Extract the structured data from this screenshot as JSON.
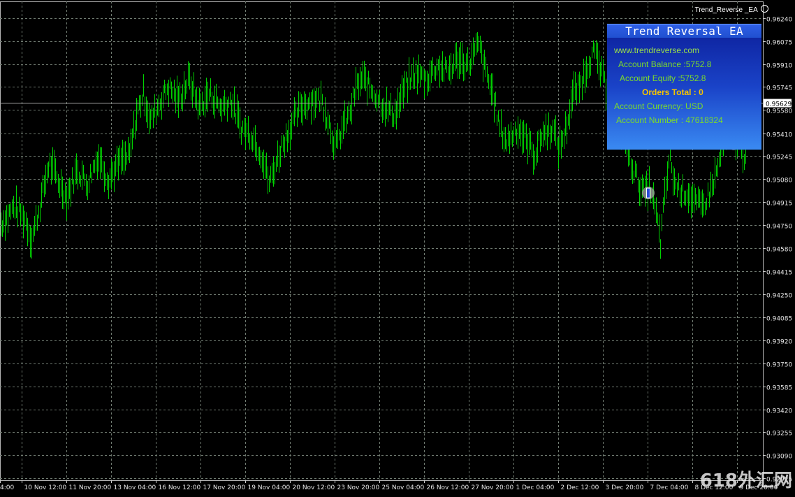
{
  "expert": {
    "name": "Trend_Reverse _EA",
    "status_icon": "smiley-icon"
  },
  "panel": {
    "title": "Trend Reversal EA",
    "url": "www.trendreverse.com",
    "account_balance": "Account Balance :5752.8",
    "account_equity": "Account Equity :5752.8",
    "orders_total": "Orders Total   : 0",
    "account_currency": "Account Currency:  USD",
    "account_number": "Account Number  :  47618324"
  },
  "watermark": "618外汇网",
  "colors": {
    "background": "#000000",
    "grid": "#6f7a70",
    "bars": "#00d200",
    "price_line": "#a8a8a8",
    "bid_label_bg": "#ffffff"
  },
  "chart_data": {
    "type": "bar",
    "current_price": "0.95629",
    "current_price_value": 0.95629,
    "ylim": [
      0.9285,
      0.964
    ],
    "y_ticks": [
      "0.96240",
      "0.96075",
      "0.95910",
      "0.95745",
      "0.95580",
      "0.95410",
      "0.95245",
      "0.95080",
      "0.94915",
      "0.94750",
      "0.94580",
      "0.94415",
      "0.94250",
      "0.94085",
      "0.93920",
      "0.93750",
      "0.93585",
      "0.93420",
      "0.93255",
      "0.93090",
      "0.92925"
    ],
    "y_tick_values": [
      0.9624,
      0.96075,
      0.9591,
      0.95745,
      0.9558,
      0.9541,
      0.95245,
      0.9508,
      0.94915,
      0.9475,
      0.9458,
      0.94415,
      0.9425,
      0.94085,
      0.9392,
      0.9375,
      0.93585,
      0.9342,
      0.93255,
      0.9309,
      0.92925
    ],
    "x_ticks": [
      "4:00",
      "10 Nov 12:00",
      "11 Nov 20:00",
      "13 Nov 04:00",
      "16 Nov 12:00",
      "17 Nov 20:00",
      "19 Nov 04:00",
      "20 Nov 12:00",
      "23 Nov 20:00",
      "25 Nov 04:00",
      "26 Nov 12:00",
      "27 Nov 20:00",
      "1 Dec 04:00",
      "2 Dec 12:00",
      "3 Dec 20:00",
      "7 Dec 04:00",
      "8 Dec 12:00",
      "9 Dec 20:00"
    ],
    "price_path": [
      [
        0,
        0.9475
      ],
      [
        20,
        0.9488
      ],
      [
        35,
        0.948
      ],
      [
        45,
        0.9465
      ],
      [
        55,
        0.9485
      ],
      [
        70,
        0.952
      ],
      [
        85,
        0.9505
      ],
      [
        95,
        0.9495
      ],
      [
        110,
        0.9515
      ],
      [
        125,
        0.9505
      ],
      [
        140,
        0.9525
      ],
      [
        155,
        0.9508
      ],
      [
        170,
        0.952
      ],
      [
        185,
        0.9525
      ],
      [
        195,
        0.9555
      ],
      [
        205,
        0.957
      ],
      [
        215,
        0.955
      ],
      [
        225,
        0.956
      ],
      [
        240,
        0.9575
      ],
      [
        255,
        0.9565
      ],
      [
        270,
        0.958
      ],
      [
        285,
        0.956
      ],
      [
        300,
        0.957
      ],
      [
        315,
        0.956
      ],
      [
        330,
        0.9565
      ],
      [
        345,
        0.9545
      ],
      [
        360,
        0.954
      ],
      [
        375,
        0.9525
      ],
      [
        385,
        0.9505
      ],
      [
        395,
        0.952
      ],
      [
        405,
        0.9535
      ],
      [
        415,
        0.9545
      ],
      [
        430,
        0.956
      ],
      [
        445,
        0.9565
      ],
      [
        460,
        0.9565
      ],
      [
        470,
        0.955
      ],
      [
        480,
        0.953
      ],
      [
        490,
        0.9545
      ],
      [
        500,
        0.9555
      ],
      [
        510,
        0.9575
      ],
      [
        520,
        0.958
      ],
      [
        535,
        0.957
      ],
      [
        550,
        0.956
      ],
      [
        565,
        0.9555
      ],
      [
        580,
        0.9575
      ],
      [
        595,
        0.9585
      ],
      [
        610,
        0.958
      ],
      [
        625,
        0.959
      ],
      [
        640,
        0.9585
      ],
      [
        655,
        0.9595
      ],
      [
        670,
        0.959
      ],
      [
        685,
        0.9605
      ],
      [
        695,
        0.9585
      ],
      [
        705,
        0.957
      ],
      [
        715,
        0.9545
      ],
      [
        725,
        0.9535
      ],
      [
        740,
        0.9545
      ],
      [
        755,
        0.9535
      ],
      [
        765,
        0.9525
      ],
      [
        775,
        0.954
      ],
      [
        790,
        0.9545
      ],
      [
        800,
        0.953
      ],
      [
        810,
        0.9545
      ],
      [
        820,
        0.957
      ],
      [
        830,
        0.9575
      ],
      [
        840,
        0.959
      ],
      [
        850,
        0.96
      ],
      [
        860,
        0.9585
      ],
      [
        870,
        0.957
      ],
      [
        880,
        0.956
      ],
      [
        890,
        0.954
      ],
      [
        900,
        0.9525
      ],
      [
        910,
        0.951
      ],
      [
        920,
        0.9498
      ],
      [
        930,
        0.9503
      ],
      [
        940,
        0.948
      ],
      [
        945,
        0.9462
      ],
      [
        950,
        0.949
      ],
      [
        958,
        0.9525
      ],
      [
        965,
        0.9505
      ],
      [
        975,
        0.95
      ],
      [
        985,
        0.9498
      ],
      [
        995,
        0.949
      ],
      [
        1005,
        0.9488
      ],
      [
        1015,
        0.9498
      ],
      [
        1025,
        0.9512
      ],
      [
        1035,
        0.9535
      ],
      [
        1045,
        0.9545
      ],
      [
        1055,
        0.9535
      ],
      [
        1065,
        0.9525
      ],
      [
        1075,
        0.9548
      ],
      [
        1085,
        0.9563
      ]
    ],
    "markers": [
      {
        "type": "buy-arrow",
        "date_index_px": 928,
        "price": 0.9498
      },
      {
        "type": "close-dot",
        "date_index_px": 1050,
        "price": 0.9533
      }
    ]
  }
}
